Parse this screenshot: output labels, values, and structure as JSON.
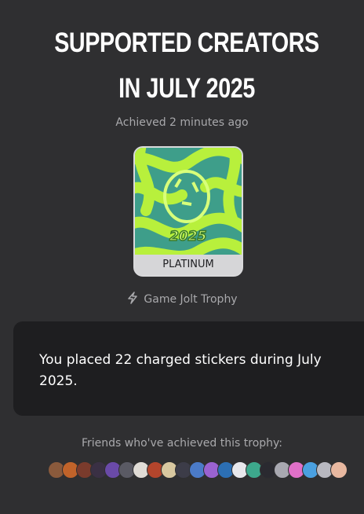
{
  "trophy": {
    "title": "SUPPORTED CREATORS IN JULY 2025",
    "achieved": "Achieved 2 minutes ago",
    "tier": "PLATINUM",
    "source": "Game Jolt Trophy",
    "description": "You placed 22 charged stickers during July 2025."
  },
  "friends": {
    "label": "Friends who've achieved this trophy:",
    "avatars": [
      {
        "color": "#8a5a3c"
      },
      {
        "color": "#c0632a"
      },
      {
        "color": "#7a3b2c"
      },
      {
        "color": "#3a3044"
      },
      {
        "color": "#6a4aa8"
      },
      {
        "color": "#5a5a64"
      },
      {
        "color": "#e0dcd6"
      },
      {
        "color": "#b3452c"
      },
      {
        "color": "#d8c8a0"
      },
      {
        "color": "#3c3c48"
      },
      {
        "color": "#4b7bc8"
      },
      {
        "color": "#9a62d0"
      },
      {
        "color": "#2c6fb4"
      },
      {
        "color": "#e8e8ec"
      },
      {
        "color": "#3da88c"
      },
      {
        "color": "#2a2a30"
      },
      {
        "color": "#a8a8b0"
      },
      {
        "color": "#e070c8"
      },
      {
        "color": "#4aa0e0"
      },
      {
        "color": "#b8b8c0"
      },
      {
        "color": "#e8b8a0"
      }
    ]
  },
  "icons": {
    "bolt": "lightning-bolt-icon"
  },
  "colors": {
    "background": "#2f2f31",
    "card": "#1e1e20",
    "muted_text": "#a9a9ac",
    "art_teal": "#3e9e8a",
    "art_lime": "#b8f03c"
  }
}
